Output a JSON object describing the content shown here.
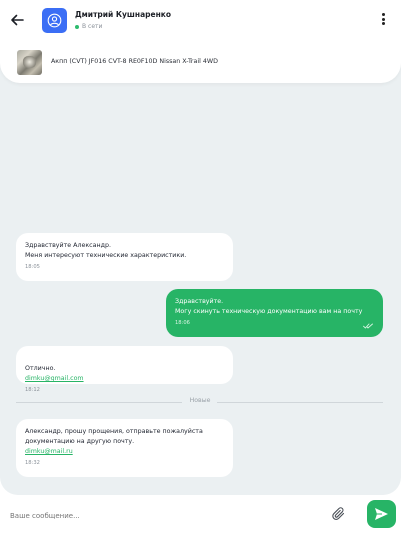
{
  "header": {
    "contact_name": "Дмитрий Кушнаренко",
    "status": "В сети",
    "status_color": "#2dbb6e",
    "avatar_color": "#3b6ef5",
    "back_icon": "arrow-left-icon",
    "menu_icon": "more-vertical-icon"
  },
  "product": {
    "title": "Акпп (CVT) JF016 CVT-8 RE0F10D Nissan X-Trail 4WD"
  },
  "messages": [
    {
      "direction": "in",
      "text": "Здравствуйте Александр.\nМеня интересуют технические характеристики.",
      "time": "18:05"
    },
    {
      "direction": "out",
      "text": "Здравствуйте.\nМогу скинуть техническую документацию вам на почту",
      "time": "18:06",
      "read": true
    },
    {
      "direction": "in",
      "text": "Отлично.",
      "link": "dimku@gmail.com",
      "time": "18:12"
    },
    {
      "direction": "in",
      "text": "Александр, прошу прощения, отправьте пожалуйста\nдокументацию на другую почту.",
      "link": "dimku@mail.ru",
      "time": "18:32"
    }
  ],
  "divider_label": "Новые",
  "composer": {
    "placeholder": "Ваше сообщение...",
    "attach_icon": "paperclip-icon",
    "send_icon": "send-icon"
  },
  "colors": {
    "accent": "#27b466",
    "chat_bg": "#ebf0f2"
  }
}
